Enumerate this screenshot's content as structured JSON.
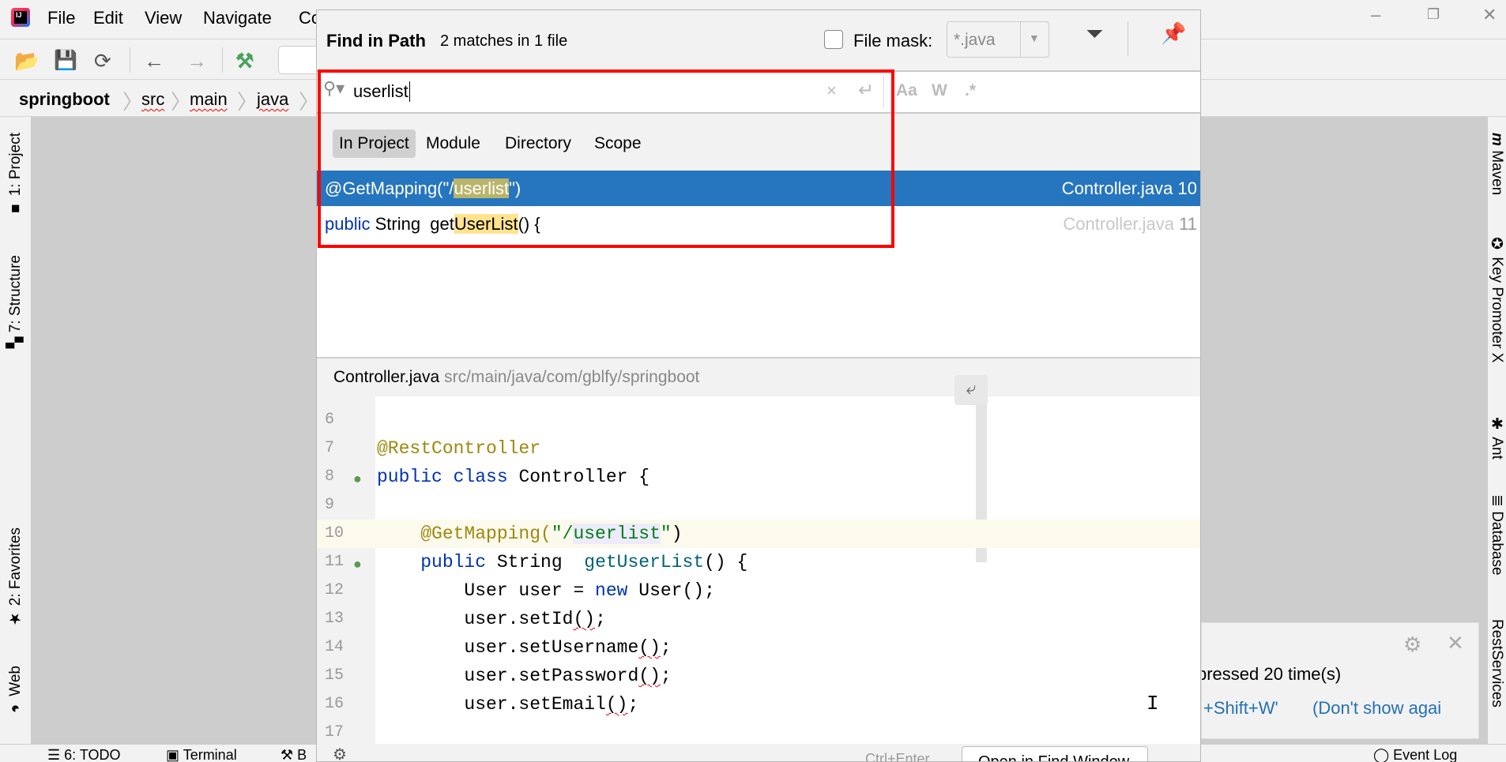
{
  "menubar": {
    "items": [
      "File",
      "Edit",
      "View",
      "Navigate",
      "Co"
    ],
    "mnemonics": [
      "F",
      "E",
      "V",
      "N",
      "C"
    ]
  },
  "breadcrumb": [
    "springboot",
    "src",
    "main",
    "java"
  ],
  "left_stripe": [
    "1: Project",
    "7: Structure",
    "2: Favorites",
    "Web"
  ],
  "right_stripe": [
    "Maven",
    "Key Promoter X",
    "Ant",
    "Database",
    "RestServices"
  ],
  "status_bar": {
    "todo": "6: TODO",
    "terminal": "Terminal",
    "b": "B",
    "event_log": "Event Log"
  },
  "find_dialog": {
    "title": "Find in Path",
    "match_count": "2 matches in 1 file",
    "file_mask_label": "File mask:",
    "file_mask_checked": false,
    "file_mask_value": "*.java",
    "search_query": "userlist",
    "options": {
      "match_case": "Aa",
      "words": "W",
      "regex": ".*"
    },
    "scopes": [
      {
        "label": "In Project",
        "active": true
      },
      {
        "label": "Module"
      },
      {
        "label": "Directory"
      },
      {
        "label": "Scope"
      }
    ],
    "results": [
      {
        "pre": "@GetMapping(\"/",
        "match": "userlist",
        "post": "\")",
        "file": "Controller.java",
        "line": "10",
        "selected": true
      },
      {
        "kw": "public",
        "pre": " String  get",
        "match": "UserList",
        "post": "() {",
        "file": "Controller.java",
        "line": "11"
      }
    ],
    "preview": {
      "file": "Controller.java",
      "path": "src/main/java/com/gblfy/springboot"
    },
    "footer": {
      "shortcut": "Ctrl+Enter",
      "open_button": "Open in Find Window"
    }
  },
  "code_lines": [
    {
      "n": "6"
    },
    {
      "n": "7"
    },
    {
      "n": "8"
    },
    {
      "n": "9"
    },
    {
      "n": "10"
    },
    {
      "n": "11"
    },
    {
      "n": "12"
    },
    {
      "n": "13"
    },
    {
      "n": "14"
    },
    {
      "n": "15"
    },
    {
      "n": "16"
    },
    {
      "n": "17"
    }
  ],
  "code": {
    "l7": "@RestController",
    "l8a": "public class",
    "l8b": " Controller {",
    "l10a": "    @GetMapping(",
    "l10b": "\"/",
    "l10c": "userlist",
    "l10d": "\"",
    ")": ")",
    "l11a": "    public",
    "l11b": " String  ",
    "l11c": "getUserList",
    "l11d": "() {",
    "l12a": "        User user = ",
    "l12b": "new",
    "l12c": " User();",
    "l13": "        user.setId",
    "l14": "        user.setUsername",
    "l15": "        user.setPassword",
    "l16": "        user.setEmail",
    "paren": "()",
    "semi": ";"
  },
  "notification": {
    "line1": "pressed 20 time(s)",
    "shortcut": "+Shift+W'",
    "dont_show": "(Don't show agai"
  },
  "colors": {
    "selection": "#2675bf",
    "highlight_box": "#ff0000",
    "match_bg": "#ffe38f"
  }
}
